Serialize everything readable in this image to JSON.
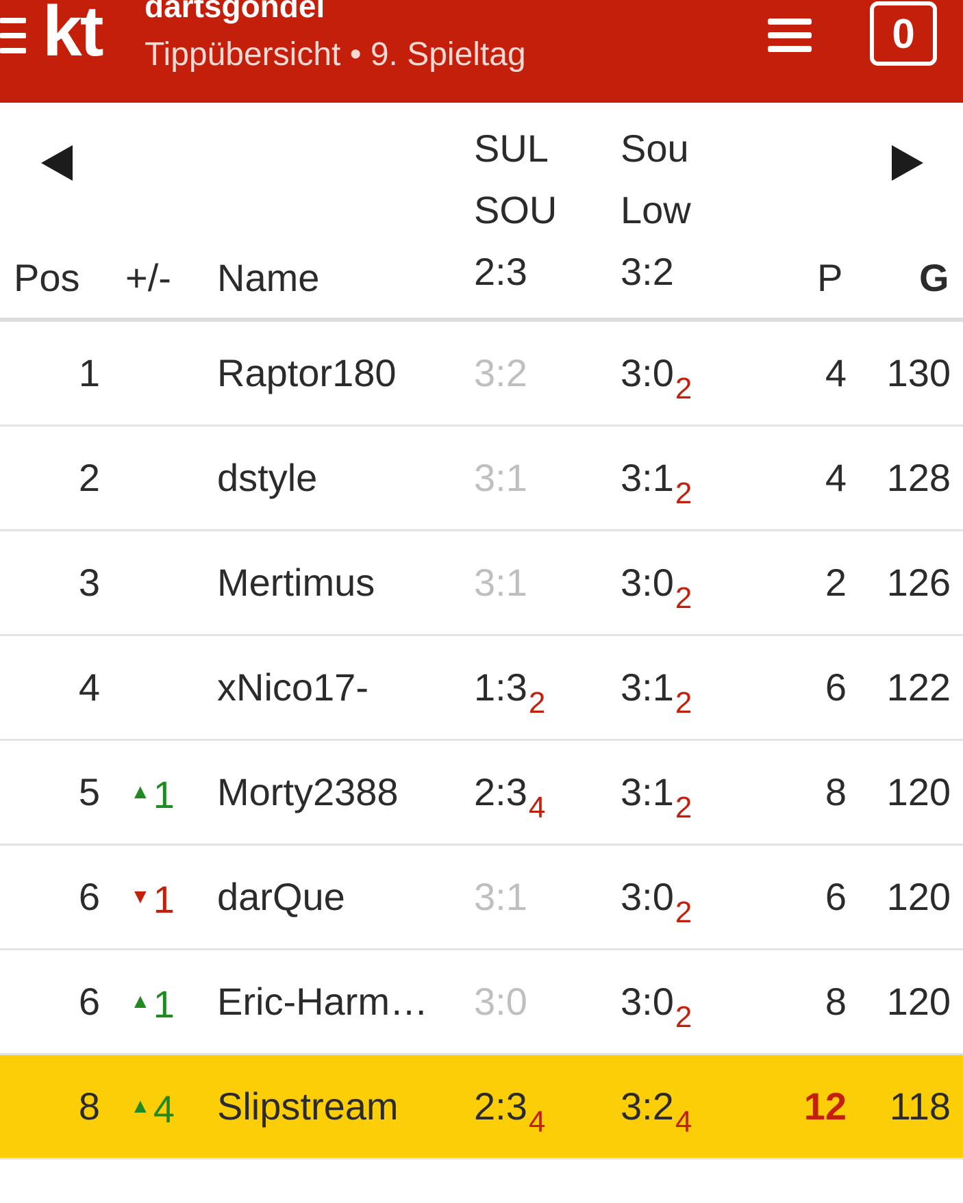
{
  "header": {
    "logo": "kt",
    "title": "dartsgondel",
    "subtitle": "Tippübersicht • 9. Spieltag",
    "counter": "0"
  },
  "columns": {
    "pos": "Pos",
    "trend": "+/-",
    "name": "Name",
    "points": "P",
    "total": "G"
  },
  "matches": [
    {
      "home": "SUL",
      "away": "SOU",
      "result": "2:3"
    },
    {
      "home": "Sou",
      "away": "Low",
      "result": "3:2"
    }
  ],
  "rows": [
    {
      "pos": "1",
      "trend_dir": "",
      "trend": "",
      "name": "Raptor180",
      "tip1": "3:2",
      "tip1_pts": "",
      "tip2": "3:0",
      "tip2_pts": "2",
      "points": "4",
      "total": "130"
    },
    {
      "pos": "2",
      "trend_dir": "",
      "trend": "",
      "name": "dstyle",
      "tip1": "3:1",
      "tip1_pts": "",
      "tip2": "3:1",
      "tip2_pts": "2",
      "points": "4",
      "total": "128"
    },
    {
      "pos": "3",
      "trend_dir": "",
      "trend": "",
      "name": "Mertimus",
      "tip1": "3:1",
      "tip1_pts": "",
      "tip2": "3:0",
      "tip2_pts": "2",
      "points": "2",
      "total": "126"
    },
    {
      "pos": "4",
      "trend_dir": "",
      "trend": "",
      "name": "xNico17-",
      "tip1": "1:3",
      "tip1_pts": "2",
      "tip2": "3:1",
      "tip2_pts": "2",
      "points": "6",
      "total": "122"
    },
    {
      "pos": "5",
      "trend_dir": "up",
      "trend": "1",
      "name": "Morty2388",
      "tip1": "2:3",
      "tip1_pts": "4",
      "tip2": "3:1",
      "tip2_pts": "2",
      "points": "8",
      "total": "120"
    },
    {
      "pos": "6",
      "trend_dir": "down",
      "trend": "1",
      "name": "darQue",
      "tip1": "3:1",
      "tip1_pts": "",
      "tip2": "3:0",
      "tip2_pts": "2",
      "points": "6",
      "total": "120"
    },
    {
      "pos": "6",
      "trend_dir": "up",
      "trend": "1",
      "name": "Eric-Harm…",
      "tip1": "3:0",
      "tip1_pts": "",
      "tip2": "3:0",
      "tip2_pts": "2",
      "points": "8",
      "total": "120"
    },
    {
      "pos": "8",
      "trend_dir": "up",
      "trend": "4",
      "name": "Slipstream",
      "tip1": "2:3",
      "tip1_pts": "4",
      "tip2": "3:2",
      "tip2_pts": "4",
      "points": "12",
      "total": "118",
      "highlight": true,
      "points_hot": true
    }
  ],
  "colors": {
    "brand_red": "#c41f0a",
    "highlight_yellow": "#fcce07",
    "trend_up_green": "#1f8a21",
    "missed_tip_gray": "#bfbfbf"
  },
  "icons": {
    "side_menu": "side-menu-icon",
    "menu": "hamburger-menu-icon",
    "prev": "triangle-left-icon",
    "next": "triangle-right-icon",
    "trend_up": "triangle-up-icon",
    "trend_down": "triangle-down-icon"
  }
}
